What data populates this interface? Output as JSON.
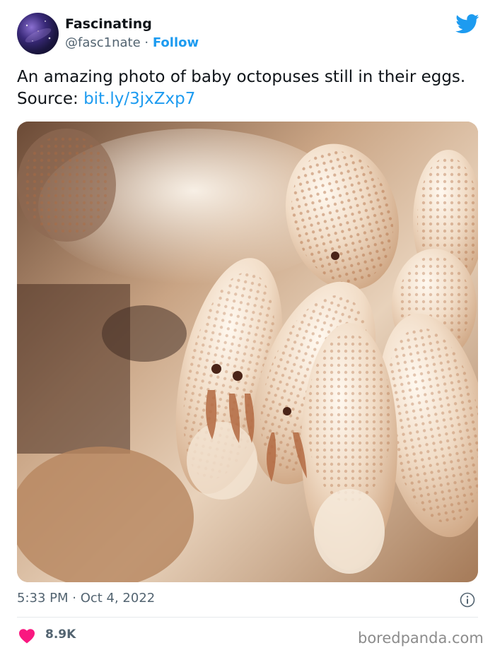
{
  "account": {
    "name": "Fascinating",
    "handle": "@fasc1nate",
    "separator": " · ",
    "follow_label": "Follow"
  },
  "tweet": {
    "text": "An amazing photo of baby octopuses still in their eggs. Source: ",
    "link": "bit.ly/3jxZxp7",
    "time": "5:33 PM · Oct 4, 2022",
    "likes": "8.9K"
  },
  "icons": {
    "brand": "twitter-bird-icon",
    "info": "info-icon",
    "like": "heart-icon"
  },
  "watermark": "boredpanda.com",
  "colors": {
    "accent": "#1d9bf0",
    "like": "#f91880",
    "secondary_text": "#536471"
  }
}
